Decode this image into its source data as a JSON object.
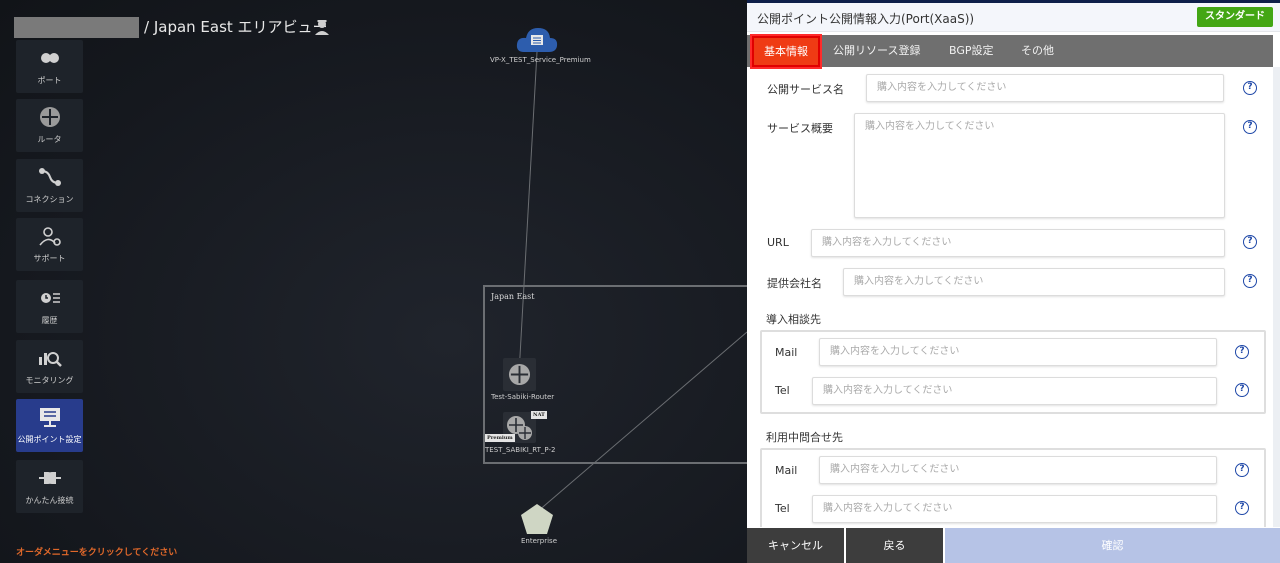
{
  "header": {
    "area_title": "/ Japan East エリアビュー"
  },
  "sidebar": {
    "items": [
      {
        "label": "ポート",
        "icon": "port-icon"
      },
      {
        "label": "ルータ",
        "icon": "router-icon"
      },
      {
        "label": "コネクション",
        "icon": "connection-icon"
      },
      {
        "label": "サポート",
        "icon": "support-icon"
      },
      {
        "label": "履歴",
        "icon": "history-icon"
      },
      {
        "label": "モニタリング",
        "icon": "monitoring-icon"
      },
      {
        "label": "公開ポイント設定",
        "icon": "public-point-icon",
        "active": true
      },
      {
        "label": "かんたん接続",
        "icon": "easy-connect-icon"
      }
    ],
    "hint": "オーダメニューをクリックしてください"
  },
  "diagram": {
    "region_label": "Japan East",
    "service_node": "VP-X_TEST_Service_Premium",
    "router_node": "Test-Sabiki-Router",
    "nat_router_node": "TEST_SABIKI_RT_P-2",
    "nat_tag": "NAT",
    "premium_tag": "Premium",
    "enterprise_node": "Enterprise"
  },
  "panel": {
    "title": "公開ポイント公開情報入力(Port(XaaS))",
    "badge": "スタンダード",
    "tabs": [
      "基本情報",
      "公開リソース登録",
      "BGP設定",
      "その他"
    ],
    "active_tab": "基本情報",
    "fields": {
      "service_name_label": "公開サービス名",
      "service_summary_label": "サービス概要",
      "url_label": "URL",
      "provider_label": "提供会社名",
      "placeholder": "購入内容を入力してください"
    },
    "groups": {
      "consult_title": "導入相談先",
      "inquiry_title": "利用中問合せ先",
      "mail_label": "Mail",
      "tel_label": "Tel"
    },
    "help_glyph": "?",
    "buttons": {
      "cancel": "キャンセル",
      "back": "戻る",
      "confirm": "確認"
    }
  },
  "colors": {
    "accent_blue": "#283c8c",
    "badge_green": "#43a614",
    "active_tab_red": "#ef3b14",
    "hint_orange": "#e0682a",
    "confirm_disabled": "#b6c3e6"
  }
}
